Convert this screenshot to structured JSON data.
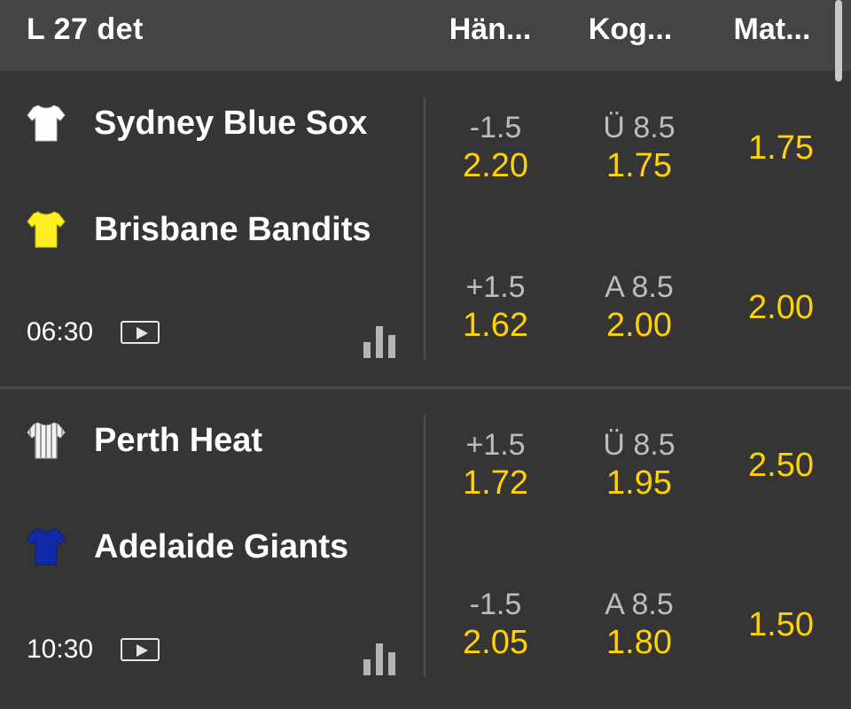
{
  "header": {
    "date": "L 27 det",
    "col_handicap": "Hän...",
    "col_total": "Kog...",
    "col_match": "Mat..."
  },
  "events": [
    {
      "home": {
        "name": "Sydney Blue Sox",
        "jersey_color": "#ffffff",
        "jersey_icon": "white-jersey-icon"
      },
      "away": {
        "name": "Brisbane Bandits",
        "jersey_color": "#ffee22",
        "jersey_icon": "yellow-jersey-icon"
      },
      "time": "06:30",
      "handicap": [
        {
          "line": "-1.5",
          "price": "2.20"
        },
        {
          "line": "+1.5",
          "price": "1.62"
        }
      ],
      "total": [
        {
          "line": "Ü 8.5",
          "price": "1.75"
        },
        {
          "line": "A 8.5",
          "price": "2.00"
        }
      ],
      "match": [
        "1.75",
        "2.00"
      ]
    },
    {
      "home": {
        "name": "Perth Heat",
        "jersey_color": "#e8e8e8",
        "jersey_icon": "striped-jersey-icon"
      },
      "away": {
        "name": "Adelaide Giants",
        "jersey_color": "#102aa8",
        "jersey_icon": "blue-jersey-icon"
      },
      "time": "10:30",
      "handicap": [
        {
          "line": "+1.5",
          "price": "1.72"
        },
        {
          "line": "-1.5",
          "price": "2.05"
        }
      ],
      "total": [
        {
          "line": "Ü 8.5",
          "price": "1.95"
        },
        {
          "line": "A 8.5",
          "price": "1.80"
        }
      ],
      "match": [
        "2.50",
        "1.50"
      ]
    }
  ],
  "colors": {
    "background": "#353535",
    "header": "#444444",
    "odds": "#ffd200",
    "line": "#bdbdbd"
  }
}
